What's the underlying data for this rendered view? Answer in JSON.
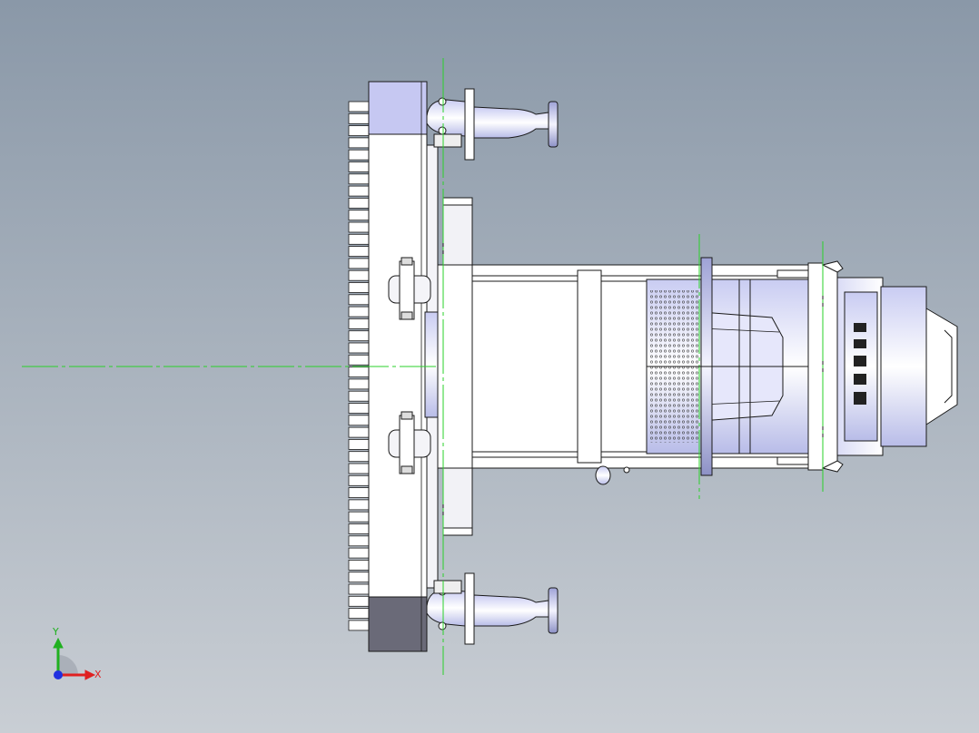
{
  "viewport": {
    "background_top": "#8a98a8",
    "background_bottom": "#c9ced4"
  },
  "model": {
    "part_fill": "#ffffff",
    "edge_color": "#1a1a1a",
    "shade_color": "#b8bde6",
    "dark_shade": "#555566",
    "centerline_color": "#2ad12a"
  },
  "triad": {
    "x_label": "X",
    "y_label": "Y",
    "x_color": "#e02020",
    "y_color": "#20b020",
    "z_color": "#2030e0"
  }
}
